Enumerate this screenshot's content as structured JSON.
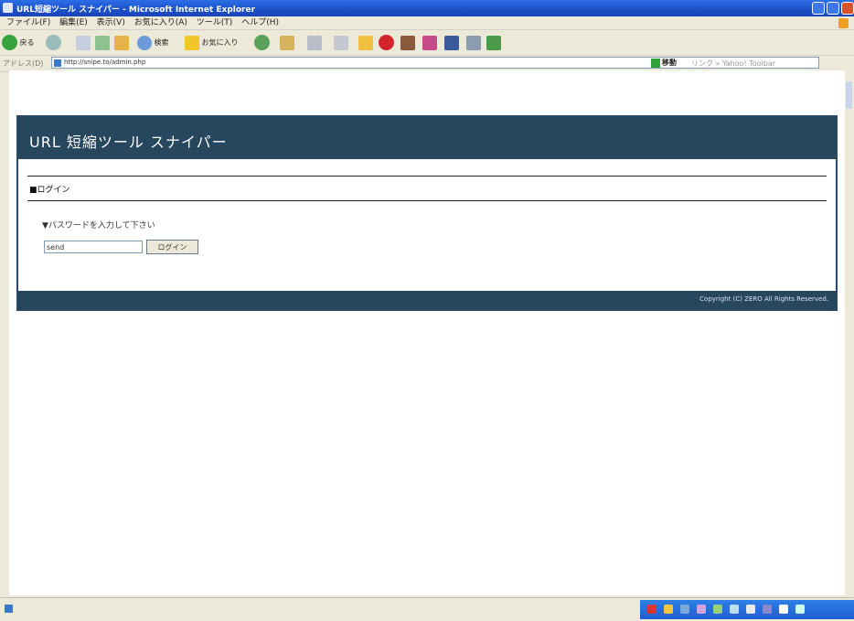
{
  "window": {
    "title": "URL短縮ツール スナイパー - Microsoft Internet Explorer"
  },
  "menu": {
    "items": [
      "ファイル(F)",
      "編集(E)",
      "表示(V)",
      "お気に入り(A)",
      "ツール(T)",
      "ヘルプ(H)"
    ]
  },
  "toolbar": {
    "back_label": "戻る",
    "search_label": "検索",
    "favorites_label": "お気に入り"
  },
  "address": {
    "label": "アドレス(D)",
    "url": "http://snipe.to/admin.php",
    "go_label": "移動",
    "links_label": "リンク » Yahoo! Toolbar"
  },
  "site": {
    "brand": "URL 短縮ツール スナイパー",
    "section_title": "■ログイン",
    "prompt": "▼パスワードを入力して下さい",
    "password_value": "send",
    "login_button": "ログイン",
    "copyright": "Copyright (C) ZERO All Rights Reserved."
  },
  "colors": {
    "header_bg": "#27475f",
    "xp_title_blue": "#1c4fc6"
  },
  "icons": [
    "ie-icon",
    "back-arrow-icon",
    "forward-arrow-icon",
    "stop-icon",
    "refresh-icon",
    "home-icon",
    "search-icon",
    "favorites-star-icon",
    "history-icon",
    "mail-icon",
    "print-icon",
    "folder-icon",
    "go-icon"
  ]
}
